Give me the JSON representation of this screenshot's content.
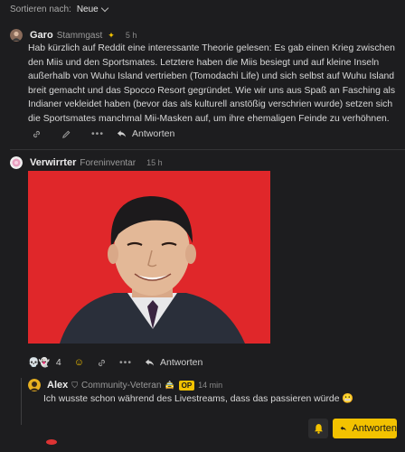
{
  "sort": {
    "label": "Sortieren nach:",
    "value": "Neue"
  },
  "post1": {
    "author": "Garo",
    "role": "Stammgast",
    "time": "5 h",
    "text": "Hab kürzlich auf Reddit eine interessante Theorie gelesen: Es gab einen Krieg zwischen den Miis und den Sportsmates. Letztere haben die Miis besiegt und auf kleine Inseln außerhalb von Wuhu Island vertrieben (Tomodachi Life) und sich selbst auf Wuhu Island breit gemacht und das Spocco Resort gegründet. Wie wir uns aus Spaß an Fasching als Indianer vekleidet haben (bevor das als kulturell anstößig verschrien wurde) setzen sich die Sportsmates manchmal Mii-Masken auf, um ihre ehemaligen Feinde zu verhöhnen.",
    "reply_label": "Antworten",
    "avatar_color": "#8a6b5a"
  },
  "post2": {
    "author": "Verwirrter",
    "role": "Foreninventar",
    "time": "15 h",
    "reaction_count": "4",
    "reply_label": "Antworten",
    "image_bg": "#e0272a",
    "avatar_color": "#e8a0c0"
  },
  "post3": {
    "author": "Alex",
    "role": "Community-Veteran",
    "badge": "OP",
    "time": "14 min",
    "text": "Ich wusste schon während des Livestreams, dass das passieren würde",
    "avatar_color": "#e8b020"
  },
  "footer": {
    "reply_button_label": "Antworten"
  },
  "colors": {
    "accent": "#f3c200",
    "background": "#1d1d1f"
  }
}
